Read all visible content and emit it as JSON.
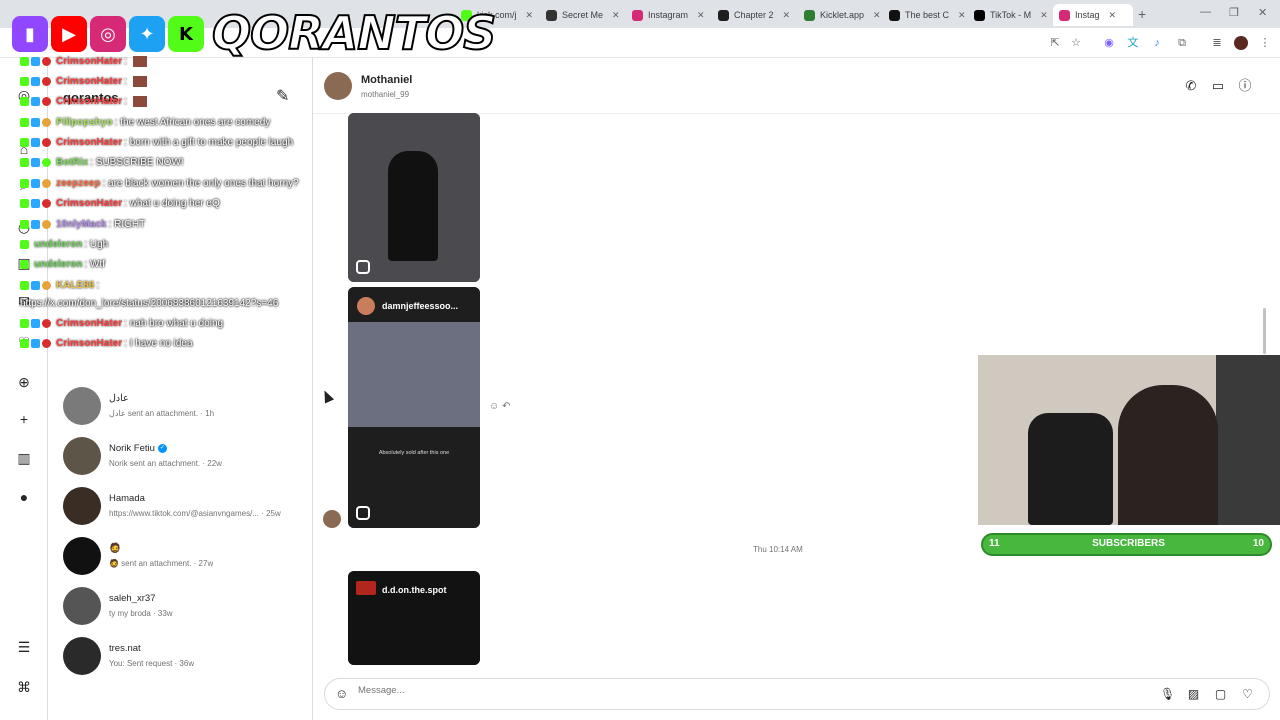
{
  "browser": {
    "tabs": [
      {
        "label": "kick.com/j",
        "color": "#53fc18"
      },
      {
        "label": "Secret Me",
        "color": "#333333"
      },
      {
        "label": "Instagram",
        "color": "#d62976"
      },
      {
        "label": "Chapter 2",
        "color": "#1f1f1f"
      },
      {
        "label": "Kicklet.app",
        "color": "#2e7d32"
      },
      {
        "label": "The best C",
        "color": "#111111"
      },
      {
        "label": "TikTok - M",
        "color": "#000000"
      },
      {
        "label": "Instag",
        "color": "#d62976"
      }
    ]
  },
  "overlay": {
    "brand": "QORANTOS",
    "chat": [
      {
        "user": "CrimsonHater",
        "color": "#ff3b3b",
        "msg": ":"
      },
      {
        "user": "CrimsonHater",
        "color": "#ff3b3b",
        "msg": ":"
      },
      {
        "user": "CrimsonHater",
        "color": "#ff3b3b",
        "msg": ":"
      },
      {
        "user": "Pillpopshyo",
        "color": "#a8e063",
        "msg": ": the west African ones are comedy"
      },
      {
        "user": "CrimsonHater",
        "color": "#ff3b3b",
        "msg": ": born with a gift to make people laugh"
      },
      {
        "user": "BotRix",
        "color": "#7ddc5a",
        "msg": ": SUBSCRIBE NOW!"
      },
      {
        "user": "zeepzeep",
        "color": "#ff6a3d",
        "msg": ": are black women the only ones that horny?"
      },
      {
        "user": "CrimsonHater",
        "color": "#ff3b3b",
        "msg": ": what u doing her eQ"
      },
      {
        "user": "10nlyMack",
        "color": "#b58ce8",
        "msg": ": RIGHT"
      },
      {
        "user": "undeleron",
        "color": "#6fd35a",
        "msg": ": Ugh"
      },
      {
        "user": "undeleron",
        "color": "#6fd35a",
        "msg": ": Wtf"
      },
      {
        "user": "KALE86",
        "color": "#e8c14a",
        "msg": ":"
      },
      {
        "user": "",
        "color": "#ffffff",
        "msg": "https://x.com/don_lore/status/200683860121639142?s=46"
      },
      {
        "user": "CrimsonHater",
        "color": "#ff3b3b",
        "msg": ": nah bro what u doing"
      },
      {
        "user": "CrimsonHater",
        "color": "#ff3b3b",
        "msg": ": I have no idea"
      }
    ]
  },
  "inbox": {
    "username": "qorantos",
    "conversations": [
      {
        "name": "عادل",
        "sub": "عادل sent an attachment. · 1h",
        "verified": false
      },
      {
        "name": "Norik Fetiu",
        "sub": "Norik sent an attachment. · 22w",
        "verified": true
      },
      {
        "name": "Hamada",
        "sub": "https://www.tiktok.com/@asianvngames/... · 25w",
        "verified": false
      },
      {
        "name": "🧔",
        "sub": "🧔 sent an attachment. · 27w",
        "verified": false
      },
      {
        "name": "saleh_xr37",
        "sub": "ty my broda · 33w",
        "verified": false
      },
      {
        "name": "tres.nat",
        "sub": "You: Sent request · 36w",
        "verified": false
      }
    ]
  },
  "chat": {
    "name": "Mothaniel",
    "handle": "mothaniel_99",
    "media": [
      {
        "title": ""
      },
      {
        "title": "damnjeffeessoo...",
        "caption": "Absolutely sold after this one"
      },
      {
        "title": "d.d.on.the.spot"
      }
    ],
    "timestamp": "Thu 10:14 AM",
    "composer_placeholder": "Message..."
  },
  "stream": {
    "sub_left": "11",
    "sub_label": "SUBSCRIBERS",
    "sub_right": "10"
  },
  "icons": [
    "search-icon",
    "home-icon",
    "reels-icon",
    "messages-icon",
    "menu-icon",
    "phone-icon",
    "video-icon",
    "info-icon",
    "emoji-icon",
    "mic-icon",
    "image-icon",
    "sticker-icon",
    "heart-icon"
  ]
}
